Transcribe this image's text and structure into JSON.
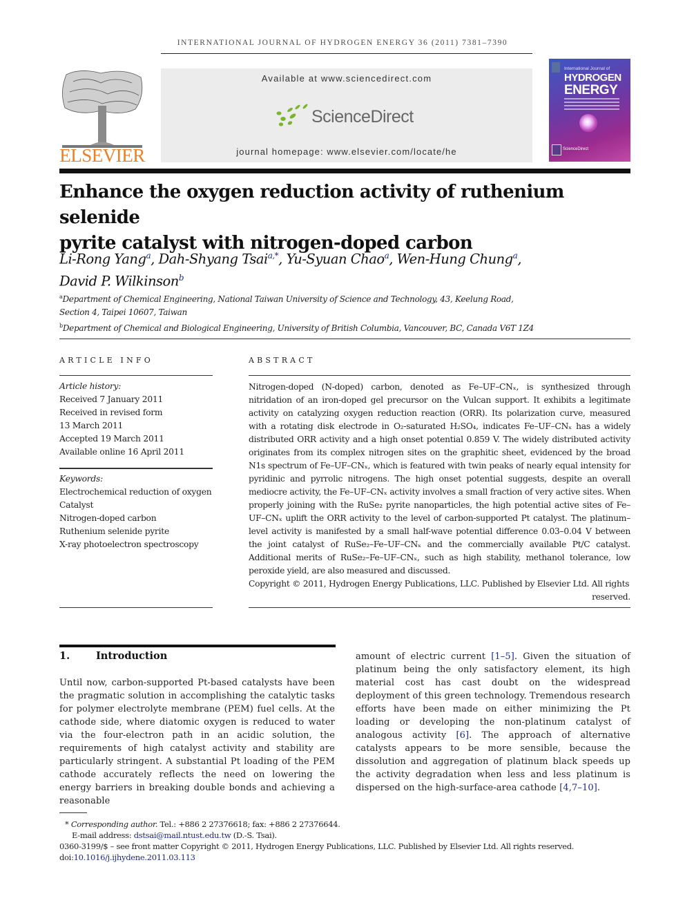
{
  "header": {
    "running_head": "INTERNATIONAL JOURNAL OF HYDROGEN ENERGY 36 (2011) 7381–7390",
    "publisher_logo": "ELSEVIER",
    "available_at": "Available at www.sciencedirect.com",
    "sciencedirect_logo": "ScienceDirect",
    "journal_homepage": "journal homepage: www.elsevier.com/locate/he",
    "cover": {
      "line1": "International Journal of",
      "line2": "HYDROGEN",
      "line3": "ENERGY",
      "footer": "ScienceDirect"
    }
  },
  "article": {
    "title_line1": "Enhance the oxygen reduction activity of ruthenium selenide",
    "title_line2": "pyrite catalyst with nitrogen-doped carbon",
    "authors": [
      {
        "name": "Li-Rong Yang",
        "sup": "a",
        "sep": ", "
      },
      {
        "name": "Dah-Shyang Tsai",
        "sup": "a,*",
        "sep": ", "
      },
      {
        "name": "Yu-Syuan Chao",
        "sup": "a",
        "sep": ", "
      },
      {
        "name": "Wen-Hung Chung",
        "sup": "a",
        "sep": ","
      },
      {
        "name": "David P. Wilkinson",
        "sup": "b",
        "sep": ""
      }
    ],
    "affiliations": [
      {
        "mark": "a",
        "line1": "Department of Chemical Engineering, National Taiwan University of Science and Technology, 43, Keelung Road,",
        "line2": "Section 4, Taipei 10607, Taiwan"
      },
      {
        "mark": "b",
        "line1": "Department of Chemical and Biological Engineering, University of British Columbia, Vancouver, BC, Canada V6T 1Z4"
      }
    ]
  },
  "article_info": {
    "heading": "ARTICLE INFO",
    "history_label": "Article history:",
    "history": [
      "Received 7 January 2011",
      "Received in revised form",
      "13 March 2011",
      "Accepted 19 March 2011",
      "Available online 16 April 2011"
    ],
    "keywords_label": "Keywords:",
    "keywords": [
      "Electrochemical reduction of oxygen",
      "Catalyst",
      "Nitrogen-doped carbon",
      "Ruthenium selenide pyrite",
      "X-ray photoelectron spectroscopy"
    ]
  },
  "abstract": {
    "heading": "ABSTRACT",
    "text": "Nitrogen-doped (N-doped) carbon, denoted as Fe–UF–CNₓ, is synthesized through nitridation of an iron-doped gel precursor on the Vulcan support. It exhibits a legitimate activity on catalyzing oxygen reduction reaction (ORR). Its polarization curve, measured with a rotating disk electrode in O₂-saturated H₂SO₄, indicates Fe–UF–CNₓ has a widely distributed ORR activity and a high onset potential 0.859 V. The widely distributed activity originates from its complex nitrogen sites on the graphitic sheet, evidenced by the broad N1s spectrum of Fe–UF–CNₓ, which is featured with twin peaks of nearly equal intensity for pyridinic and pyrrolic nitrogens. The high onset potential suggests, despite an overall mediocre activity, the Fe–UF–CNₓ activity involves a small fraction of very active sites. When properly joining with the RuSe₂ pyrite nanoparticles, the high potential active sites of Fe–UF–CNₓ uplift the ORR activity to the level of carbon-supported Pt catalyst. The platinum–level activity is manifested by a small half-wave potential difference 0.03–0.04 V between the joint catalyst of RuSe₂–Fe–UF–CNₓ and the commercially available Pt/C catalyst. Additional merits of RuSe₂–Fe–UF–CNₓ, such as high stability, methanol tolerance, low peroxide yield, are also measured and discussed.",
    "copyright_main": "Copyright © 2011, Hydrogen Energy Publications, LLC. Published by Elsevier Ltd. All rights",
    "copyright_end": "reserved."
  },
  "introduction": {
    "number": "1.",
    "heading": "Introduction",
    "left_text": "Until now, carbon-supported Pt-based catalysts have been the pragmatic solution in accomplishing the catalytic tasks for polymer electrolyte membrane (PEM) fuel cells. At the cathode side, where diatomic oxygen is reduced to water via the four-electron path in an acidic solution, the requirements of high catalyst activity and stability are particularly stringent. A substantial Pt loading of the PEM cathode accurately reflects the need on lowering the energy barriers in breaking double bonds and achieving a reasonable",
    "right_parts": [
      {
        "t": "amount of electric current "
      },
      {
        "cite": "[1–5]"
      },
      {
        "t": ". Given the situation of platinum being the only satisfactory element, its high material cost has cast doubt on the widespread deployment of this green technology. Tremendous research efforts have been made on either minimizing the Pt loading or developing the non-platinum catalyst of analogous activity "
      },
      {
        "cite": "[6]"
      },
      {
        "t": ". The approach of alternative catalysts appears to be more sensible, because the dissolution and aggregation of platinum black speeds up the activity degradation when less and less platinum is dispersed on the high-surface-area cathode "
      },
      {
        "cite": "[4,7–10]"
      },
      {
        "t": "."
      }
    ]
  },
  "footnotes": {
    "corresponding_mark": "*",
    "corresponding_label": "Corresponding author.",
    "contact": " Tel.: +886 2 27376618; fax: +886 2 27376644.",
    "email_label": "E-mail address: ",
    "email": "dstsai@mail.ntust.edu.tw",
    "email_suffix": " (D.-S. Tsai).",
    "front_matter": "0360-3199/$ – see front matter Copyright © 2011, Hydrogen Energy Publications, LLC. Published by Elsevier Ltd. All rights reserved.",
    "doi_label": "doi:",
    "doi": "10.1016/j.ijhydene.2011.03.113"
  }
}
